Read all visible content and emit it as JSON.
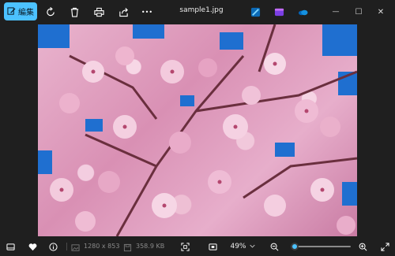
{
  "toolbar": {
    "edit_label": "編集",
    "rotate_icon": "rotate-icon",
    "delete_icon": "trash-icon",
    "print_icon": "printer-icon",
    "share_icon": "share-icon",
    "more_label": "•••"
  },
  "window": {
    "title": "sample1.jpg",
    "app_icons": [
      "photos-editor-icon",
      "clipchamp-icon",
      "onedrive-icon"
    ],
    "controls": {
      "minimize": "—",
      "maximize": "☐",
      "close": "✕"
    }
  },
  "image": {
    "description_name": "cherry-blossom-photo"
  },
  "statusbar": {
    "dimensions": "1280 x 853",
    "file_size": "358.9 KB",
    "zoom_value": "49%",
    "zoom_fraction": 0.06
  },
  "colors": {
    "accent": "#4cc2ff",
    "background": "#1f1f1f",
    "sky": "#1f6fd0"
  }
}
